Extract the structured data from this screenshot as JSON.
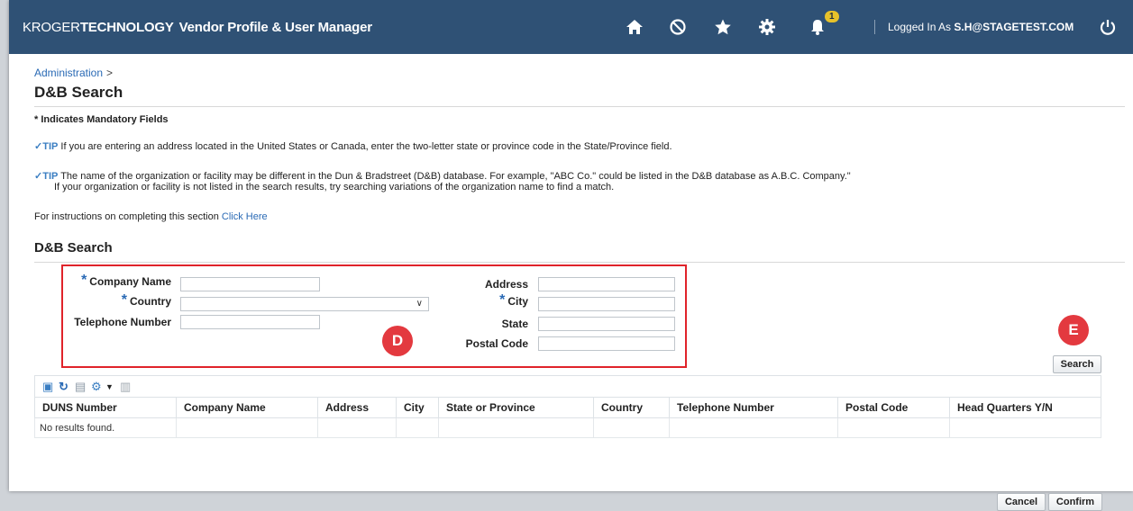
{
  "header": {
    "brand_kroger": "KROGER",
    "brand_tech": "TECHNOLOGY",
    "app_title": "Vendor Profile & User Manager",
    "notification_count": "1",
    "logged_in_prefix": "Logged In As",
    "logged_in_user": "S.H@STAGETEST.COM",
    "icons": [
      "home-icon",
      "prohibited-icon",
      "star-icon",
      "gear-icon",
      "bell-icon",
      "power-icon"
    ]
  },
  "breadcrumb": {
    "item": "Administration",
    "separator": ">"
  },
  "page_title": "D&B Search",
  "mandatory_note": "* Indicates Mandatory Fields",
  "tips": {
    "label": "TIP",
    "tip1": "If you are entering an address located in the United States or Canada, enter the two-letter state or province code in the State/Province field.",
    "tip2_line1": "The name of the organization or facility may be different in the Dun & Bradstreet (D&B) database. For example, \"ABC Co.\" could be listed in the D&B database as A.B.C. Company.\"",
    "tip2_line2": "If your organization or facility is not listed in the search results, try searching variations of the organization name to find a match."
  },
  "instructions": {
    "text": "For instructions on completing this section",
    "link": "Click Here"
  },
  "section_title": "D&B Search",
  "form": {
    "company_name_label": "Company Name",
    "country_label": "Country",
    "telephone_label": "Telephone Number",
    "address_label": "Address",
    "city_label": "City",
    "state_label": "State",
    "postal_label": "Postal Code",
    "required_marker": "*",
    "company_name_value": "",
    "country_value": "",
    "telephone_value": "",
    "address_value": "",
    "city_value": "",
    "state_value": "",
    "postal_value": ""
  },
  "annotations": {
    "d": "D",
    "e": "E"
  },
  "search_button": "Search",
  "table": {
    "columns": [
      "DUNS Number",
      "Company Name",
      "Address",
      "City",
      "State or Province",
      "Country",
      "Telephone Number",
      "Postal Code",
      "Head Quarters Y/N"
    ],
    "empty_message": "No results found."
  },
  "footer": {
    "cancel": "Cancel",
    "confirm": "Confirm"
  },
  "colors": {
    "topbar": "#2f5175",
    "accent": "#2a6ab5",
    "annotation_red": "#e3393f",
    "badge": "#e7c22a"
  }
}
